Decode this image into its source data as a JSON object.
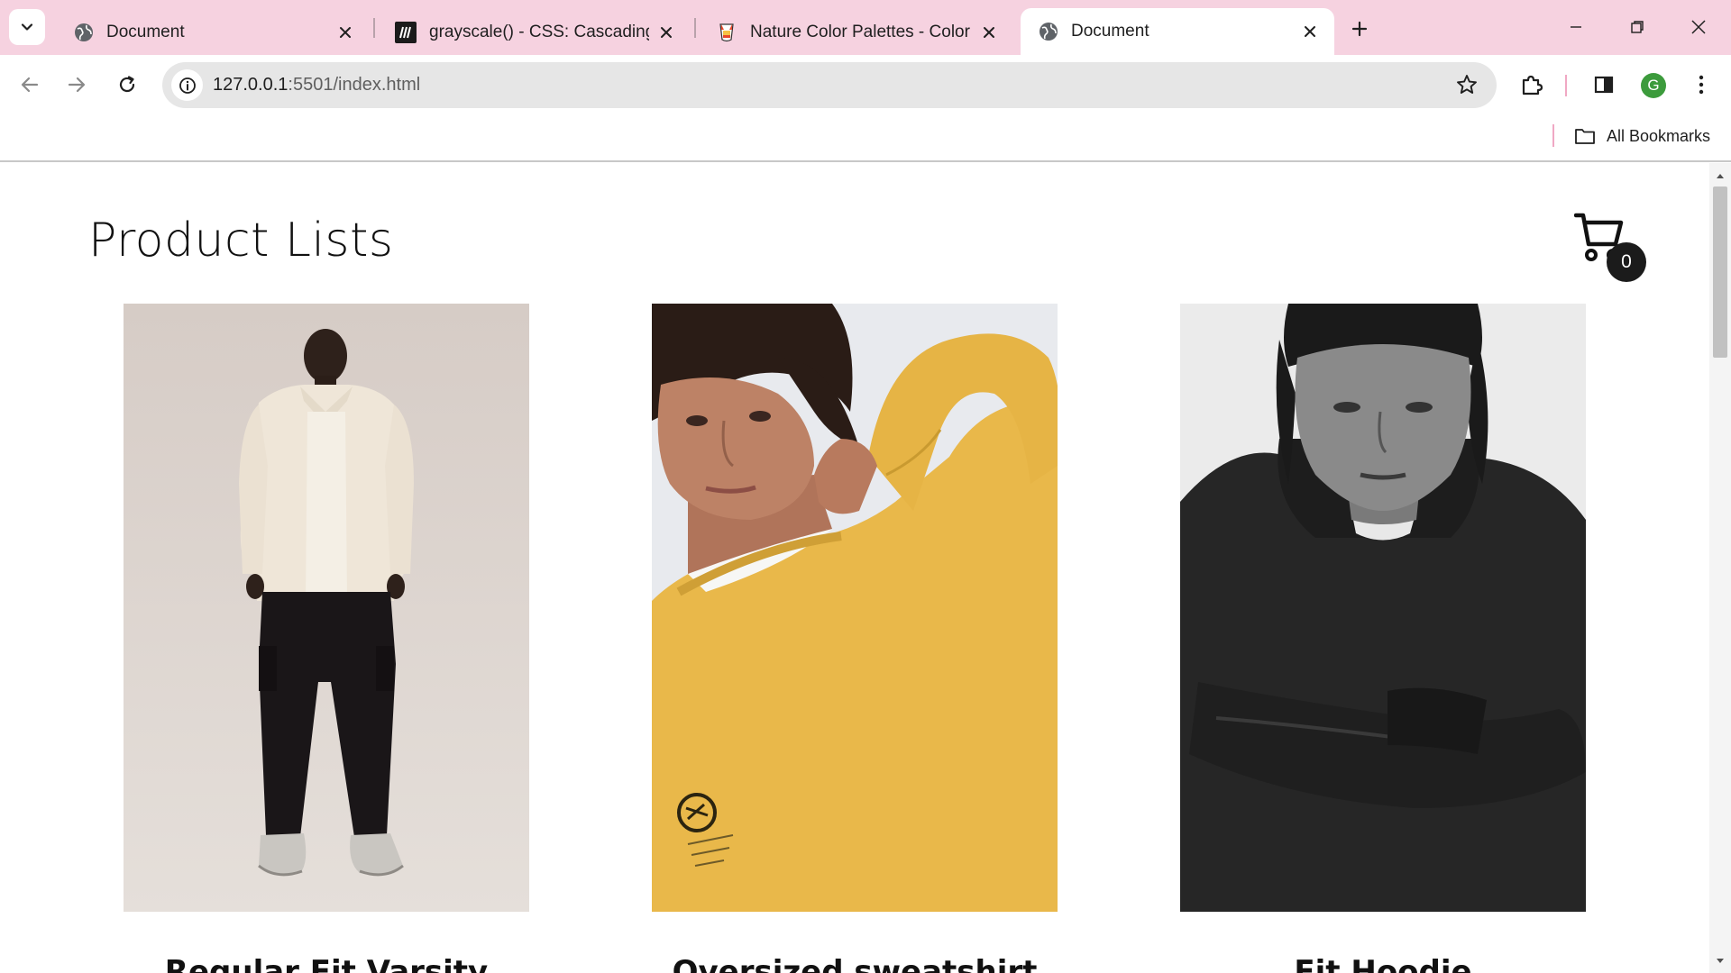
{
  "browser": {
    "tabs": [
      {
        "title": "Document",
        "icon": "globe-icon",
        "active": false
      },
      {
        "title": "grayscale() - CSS: Cascading Sty",
        "icon": "mdn-icon",
        "active": false
      },
      {
        "title": "Nature Color Palettes - Color Hu",
        "icon": "colorhunt-icon",
        "active": false
      },
      {
        "title": "Document",
        "icon": "globe-icon",
        "active": true
      }
    ],
    "address": {
      "host": "127.0.0.1",
      "path": ":5501/index.html"
    },
    "profile_initial": "G",
    "bookmarks": {
      "all_label": "All Bookmarks"
    },
    "colors": {
      "tabstrip": "#f6d2e0",
      "accent": "#f0a8c4",
      "profile": "#3c9b3c"
    }
  },
  "page": {
    "title": "Product Lists",
    "cart": {
      "count": "0",
      "icon": "cart-icon"
    },
    "products": [
      {
        "name": "Regular Fit Varsity",
        "image": "man in cream fleece jacket and black cargo pants"
      },
      {
        "name": "Oversized sweatshirt",
        "image": "man in yellow sweatshirt"
      },
      {
        "name": "Fit Hoodie",
        "image": "man in black hoodie, black and white photo"
      }
    ]
  }
}
